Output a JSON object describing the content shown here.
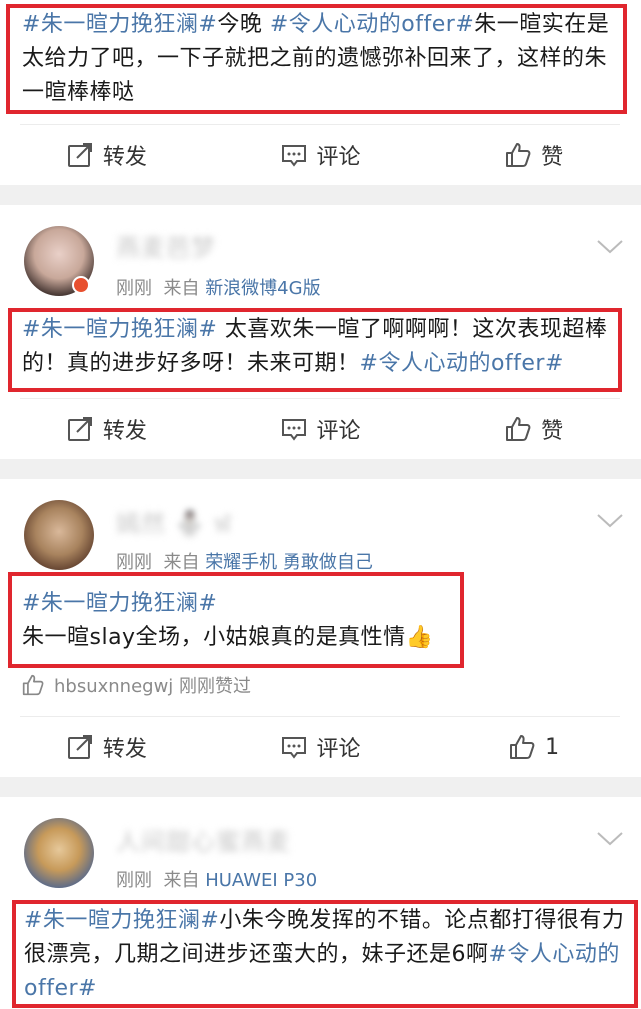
{
  "posts": [
    {
      "text": [
        {
          "t": "#朱一暄力挽狂澜#",
          "topic": true
        },
        {
          "t": "今晚 ",
          "topic": false
        },
        {
          "t": "#令人心动的offer#",
          "topic": true
        },
        {
          "t": "朱一暄实在是太给力了吧，一下子就把之前的遗憾弥补回来了，这样的朱一暄棒棒哒",
          "topic": false
        }
      ],
      "actions": {
        "repost": "转发",
        "comment": "评论",
        "like": "赞"
      }
    },
    {
      "user": {
        "name": "燕麦芭梦",
        "time": "刚刚",
        "from_prefix": "来自",
        "source": "新浪微博4G版"
      },
      "text": [
        {
          "t": "#朱一暄力挽狂澜#",
          "topic": true
        },
        {
          "t": " 太喜欢朱一暄了啊啊啊！这次表现超棒的！真的进步好多呀！未来可期！",
          "topic": false
        },
        {
          "t": "#令人心动的offer#",
          "topic": true
        }
      ],
      "actions": {
        "repost": "转发",
        "comment": "评论",
        "like": "赞"
      }
    },
    {
      "user": {
        "name": "嫣然 ⛄ ฬ",
        "time": "刚刚",
        "from_prefix": "来自",
        "source": "荣耀手机 勇敢做自己"
      },
      "text": [
        {
          "t": "#朱一暄力挽狂澜#",
          "topic": true
        },
        {
          "t": "\n朱一暄slay全场，小姑娘真的是真性情👍",
          "topic": false
        }
      ],
      "liked_by": {
        "user": "hbsuxnnegwj",
        "suffix": "刚刚赞过"
      },
      "actions": {
        "repost": "转发",
        "comment": "评论",
        "like": "1"
      }
    },
    {
      "user": {
        "name": "人间甜心蜜燕麦",
        "time": "刚刚",
        "from_prefix": "来自",
        "source": "HUAWEI P30"
      },
      "text": [
        {
          "t": "#朱一暄力挽狂澜#",
          "topic": true
        },
        {
          "t": "小朱今晚发挥的不错。论点都打得很有力很漂亮，几期之间进步还蛮大的，妹子还是6啊",
          "topic": false
        },
        {
          "t": "#令人心动的offer#",
          "topic": true
        }
      ]
    }
  ],
  "colors": {
    "topic": "#4a76a8",
    "highlight": "#e0262e",
    "separator": "#f0f0f0"
  }
}
